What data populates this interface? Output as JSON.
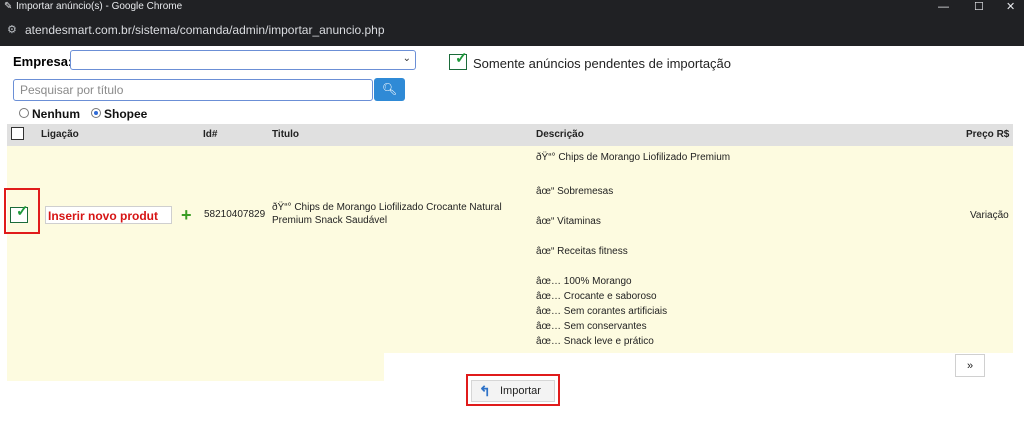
{
  "window": {
    "title": "Importar anúncio(s) - Google Chrome",
    "app_icon": "feather-icon",
    "controls": {
      "minimize": "—",
      "maximize": "☐",
      "close": "✕"
    }
  },
  "address_bar": {
    "url": "atendesmart.com.br/sistema/comanda/admin/importar_anuncio.php",
    "site_icon": "tune-icon"
  },
  "filters": {
    "empresa_label": "Empresa:",
    "empresa_value": "",
    "somente_pendentes_label": "Somente anúncios pendentes de importação",
    "somente_pendentes_checked": true,
    "search_placeholder": "Pesquisar por título",
    "radios": [
      {
        "label": "Nenhum",
        "selected": false
      },
      {
        "label": "Shopee",
        "selected": true
      }
    ]
  },
  "table": {
    "headers": [
      "Ligação",
      "Id#",
      "Titulo",
      "Descrição",
      "Preço R$"
    ],
    "rows": [
      {
        "checked": true,
        "action_label": "Inserir novo produt",
        "id": "58210407829",
        "title_lines": [
          "ðŸ“° Chips de Morango Liofilizado Crocante Natural",
          "Premium Snack Saudável"
        ],
        "description_lines": [
          "ðŸ“° Chips de Morango Liofilizado Premium",
          "âœ“ Sobremesas",
          "âœ“ Vitaminas",
          "âœ“ Receitas fitness",
          "âœ… 100% Morango",
          "âœ… Crocante e saboroso",
          "âœ… Sem corantes artificiais",
          "âœ… Sem conservantes",
          "âœ… Snack leve e prático"
        ],
        "price": "Variação"
      }
    ]
  },
  "pagination": {
    "next_label": "»"
  },
  "import_button": {
    "label": "Importar",
    "icon": "import-icon"
  },
  "colors": {
    "row_highlight": "#fdfbe0",
    "accent_blue": "#2f8ad6",
    "annotation_red": "#e01b1b",
    "insert_red": "#d61414"
  }
}
